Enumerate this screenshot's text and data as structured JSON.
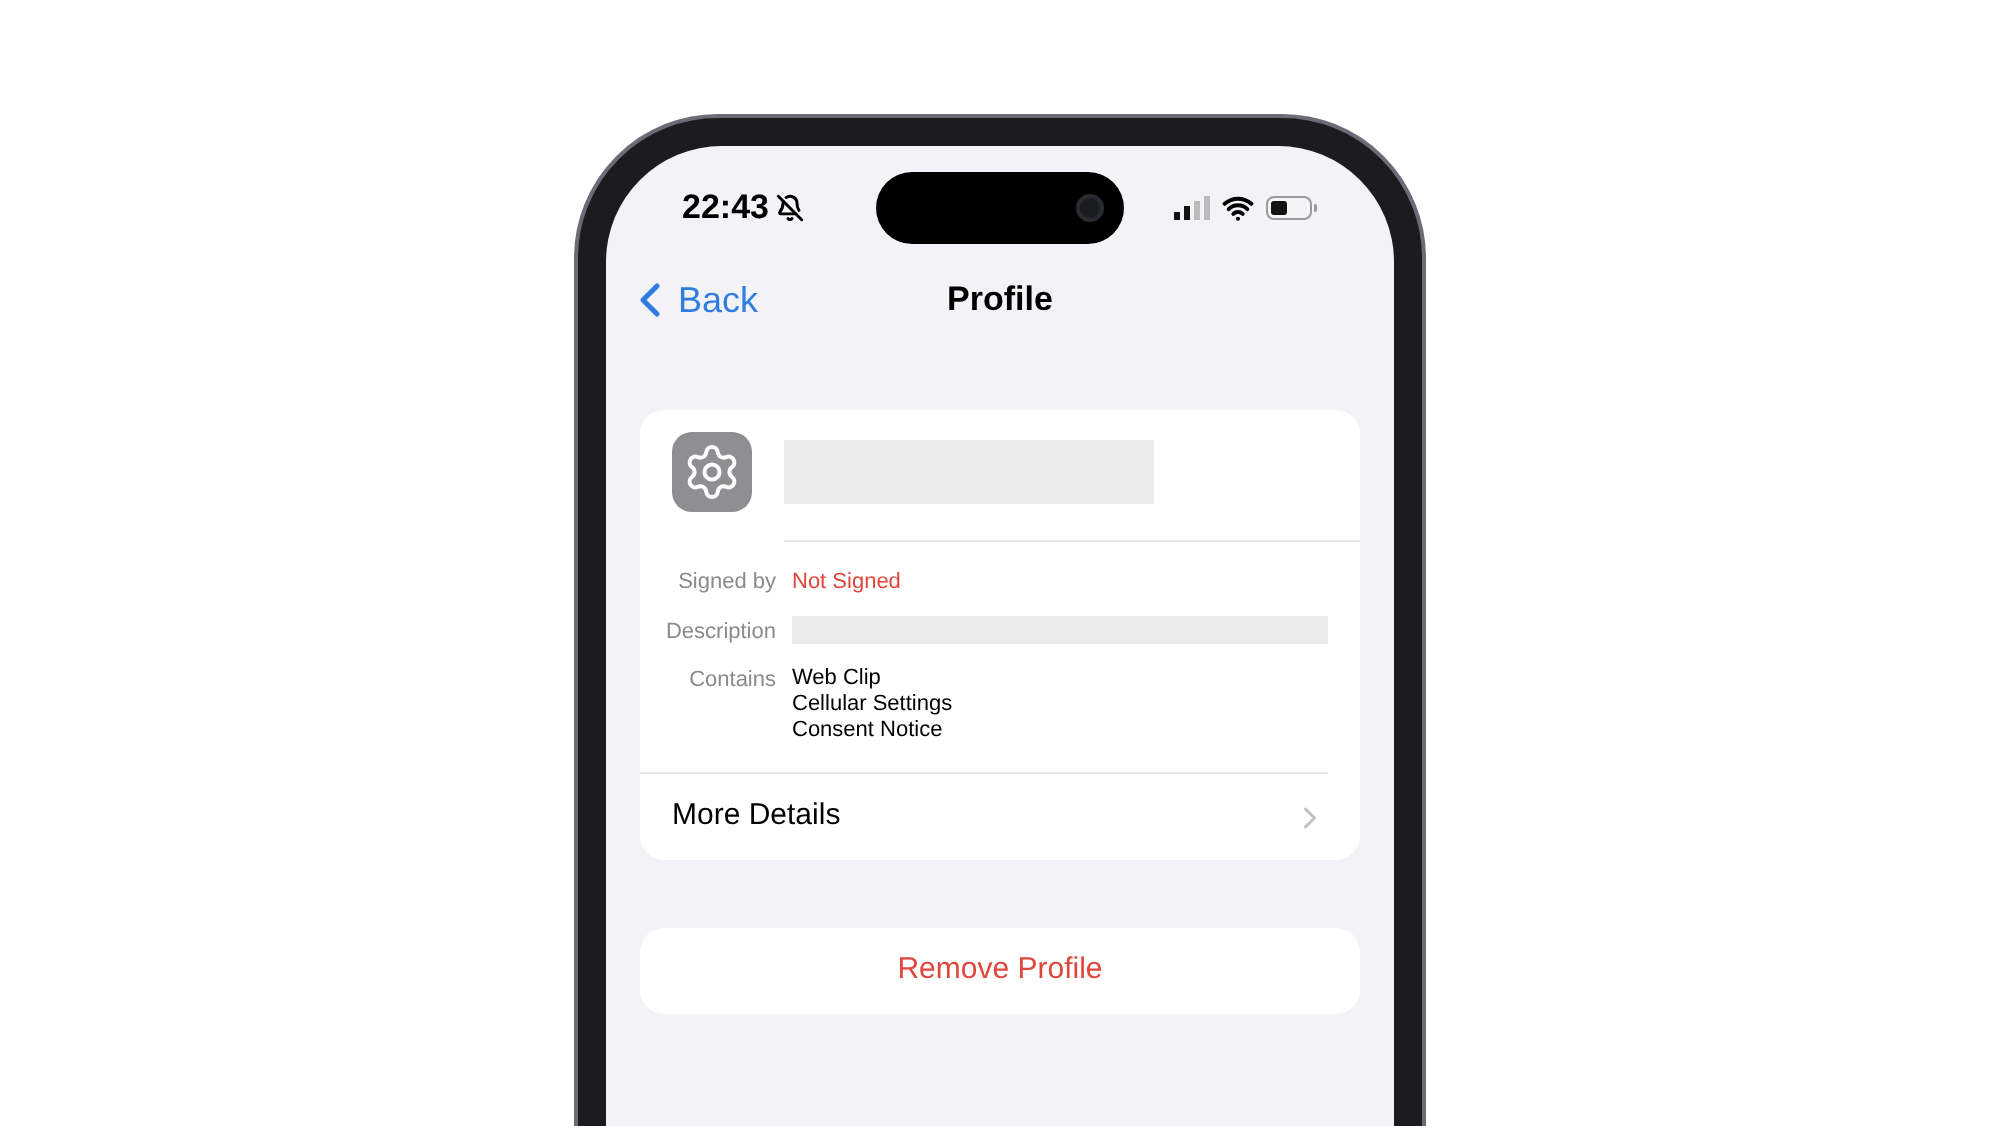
{
  "status_bar": {
    "time": "22:43"
  },
  "nav": {
    "back": "Back",
    "title": "Profile"
  },
  "profile": {
    "fields": [
      {
        "label": "Signed by",
        "kind": "warning",
        "values": [
          "Not Signed"
        ]
      },
      {
        "label": "Description",
        "kind": "redacted"
      },
      {
        "label": "Contains",
        "kind": "list",
        "values": [
          "Web Clip",
          "Cellular Settings",
          "Consent Notice"
        ]
      }
    ],
    "more_details": "More Details"
  },
  "remove_button": "Remove Profile"
}
